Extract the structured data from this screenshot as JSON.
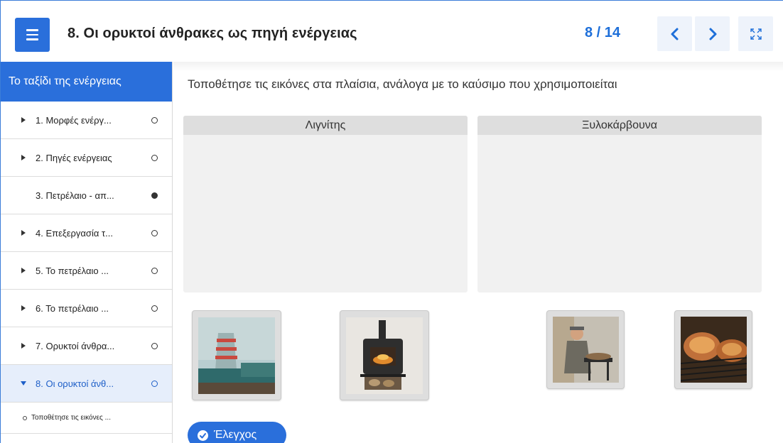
{
  "header": {
    "title": "8. Οι ορυκτοί άνθρακες ως πηγή ενέργειας",
    "counter": "8 / 14"
  },
  "sidebar": {
    "heading": "Το ταξίδι της ενέργειας",
    "items": [
      {
        "label": "1. Μορφές ενέργ...",
        "status": "open"
      },
      {
        "label": "2. Πηγές ενέργειας",
        "status": "open"
      },
      {
        "label": "3. Πετρέλαιο - απ...",
        "status": "filled"
      },
      {
        "label": "4. Επεξεργασία τ...",
        "status": "open"
      },
      {
        "label": "5. Το πετρέλαιο ...",
        "status": "open"
      },
      {
        "label": "6. Το πετρέλαιο ...",
        "status": "open"
      },
      {
        "label": "7. Ορυκτοί άνθρα...",
        "status": "open"
      },
      {
        "label": "8. Οι ορυκτοί άνθ...",
        "status": "open"
      }
    ],
    "sub_item": "Τοποθέτησε τις εικόνες ..."
  },
  "main": {
    "instruction": "Τοποθέτησε τις εικόνες στα πλαίσια, ανάλογα με το καύσιμο που χρησιμοποιείται",
    "zones": [
      "Λιγνίτης",
      "Ξυλοκάρβουνα"
    ],
    "check_label": "Έλεγχος"
  },
  "colors": {
    "accent": "#2a6fdb",
    "counter": "#1e6fd9",
    "active_bg": "#e6eefb",
    "zone_bg": "#f1f1f1",
    "zone_head": "#dedede"
  },
  "icons": [
    "hamburger-icon",
    "chevron-left-icon",
    "chevron-right-icon",
    "fullscreen-icon",
    "caret-right-icon",
    "caret-down-icon",
    "check-circle-icon"
  ]
}
